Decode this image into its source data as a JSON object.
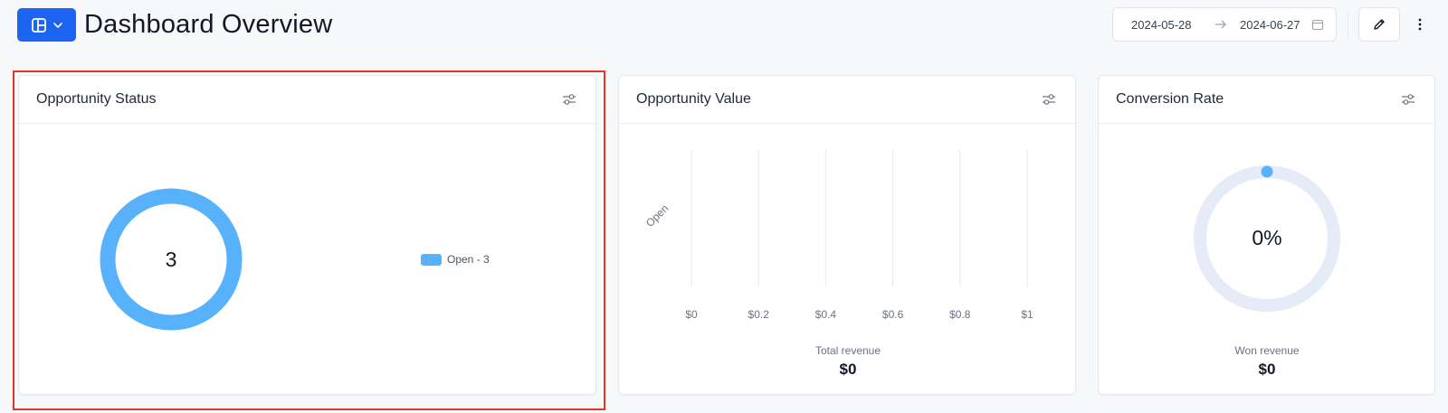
{
  "header": {
    "title": "Dashboard Overview",
    "date_start": "2024-05-28",
    "date_end": "2024-06-27"
  },
  "colors": {
    "primary": "#1c64f2",
    "series_open": "#58b1fb",
    "ring_track": "#e6ecf7",
    "selection": "#e5332a"
  },
  "cards": {
    "status": {
      "title": "Opportunity Status",
      "total": "3",
      "legend": [
        {
          "label": "Open - 3",
          "color": "#58b1fb"
        }
      ]
    },
    "value": {
      "title": "Opportunity Value",
      "summary_label": "Total revenue",
      "summary_value": "$0"
    },
    "conversion": {
      "title": "Conversion Rate",
      "center_value": "0%",
      "summary_label": "Won revenue",
      "summary_value": "$0"
    }
  },
  "chart_data": [
    {
      "type": "pie",
      "title": "Opportunity Status",
      "categories": [
        "Open"
      ],
      "values": [
        3
      ],
      "legend": "right"
    },
    {
      "type": "bar",
      "title": "Opportunity Value",
      "orientation": "horizontal",
      "categories": [
        "Open"
      ],
      "values": [
        0
      ],
      "xlim": [
        0,
        1
      ],
      "xticks": [
        "$0",
        "$0.2",
        "$0.4",
        "$0.6",
        "$0.8",
        "$1"
      ],
      "grid": true
    },
    {
      "type": "pie",
      "title": "Conversion Rate",
      "categories": [
        "Won"
      ],
      "values": [
        0
      ],
      "center_label": "0%"
    }
  ]
}
